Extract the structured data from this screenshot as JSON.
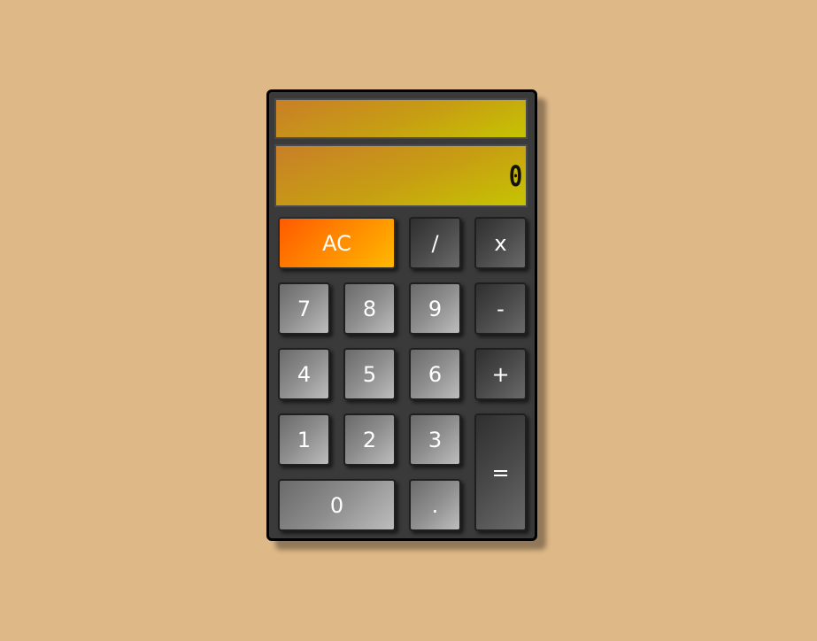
{
  "display": {
    "previous": "",
    "current": "0"
  },
  "keys": {
    "ac": "AC",
    "divide": "/",
    "multiply": "x",
    "seven": "7",
    "eight": "8",
    "nine": "9",
    "subtract": "-",
    "four": "4",
    "five": "5",
    "six": "6",
    "add": "+",
    "one": "1",
    "two": "2",
    "three": "3",
    "equals": "=",
    "zero": "0",
    "decimal": "."
  },
  "colors": {
    "background": "#deb887",
    "body": "#3a3a3a",
    "ac_start": "#ff5a00",
    "ac_end": "#ffb800",
    "display_start": "#c87f27",
    "display_end": "#c6c402"
  }
}
